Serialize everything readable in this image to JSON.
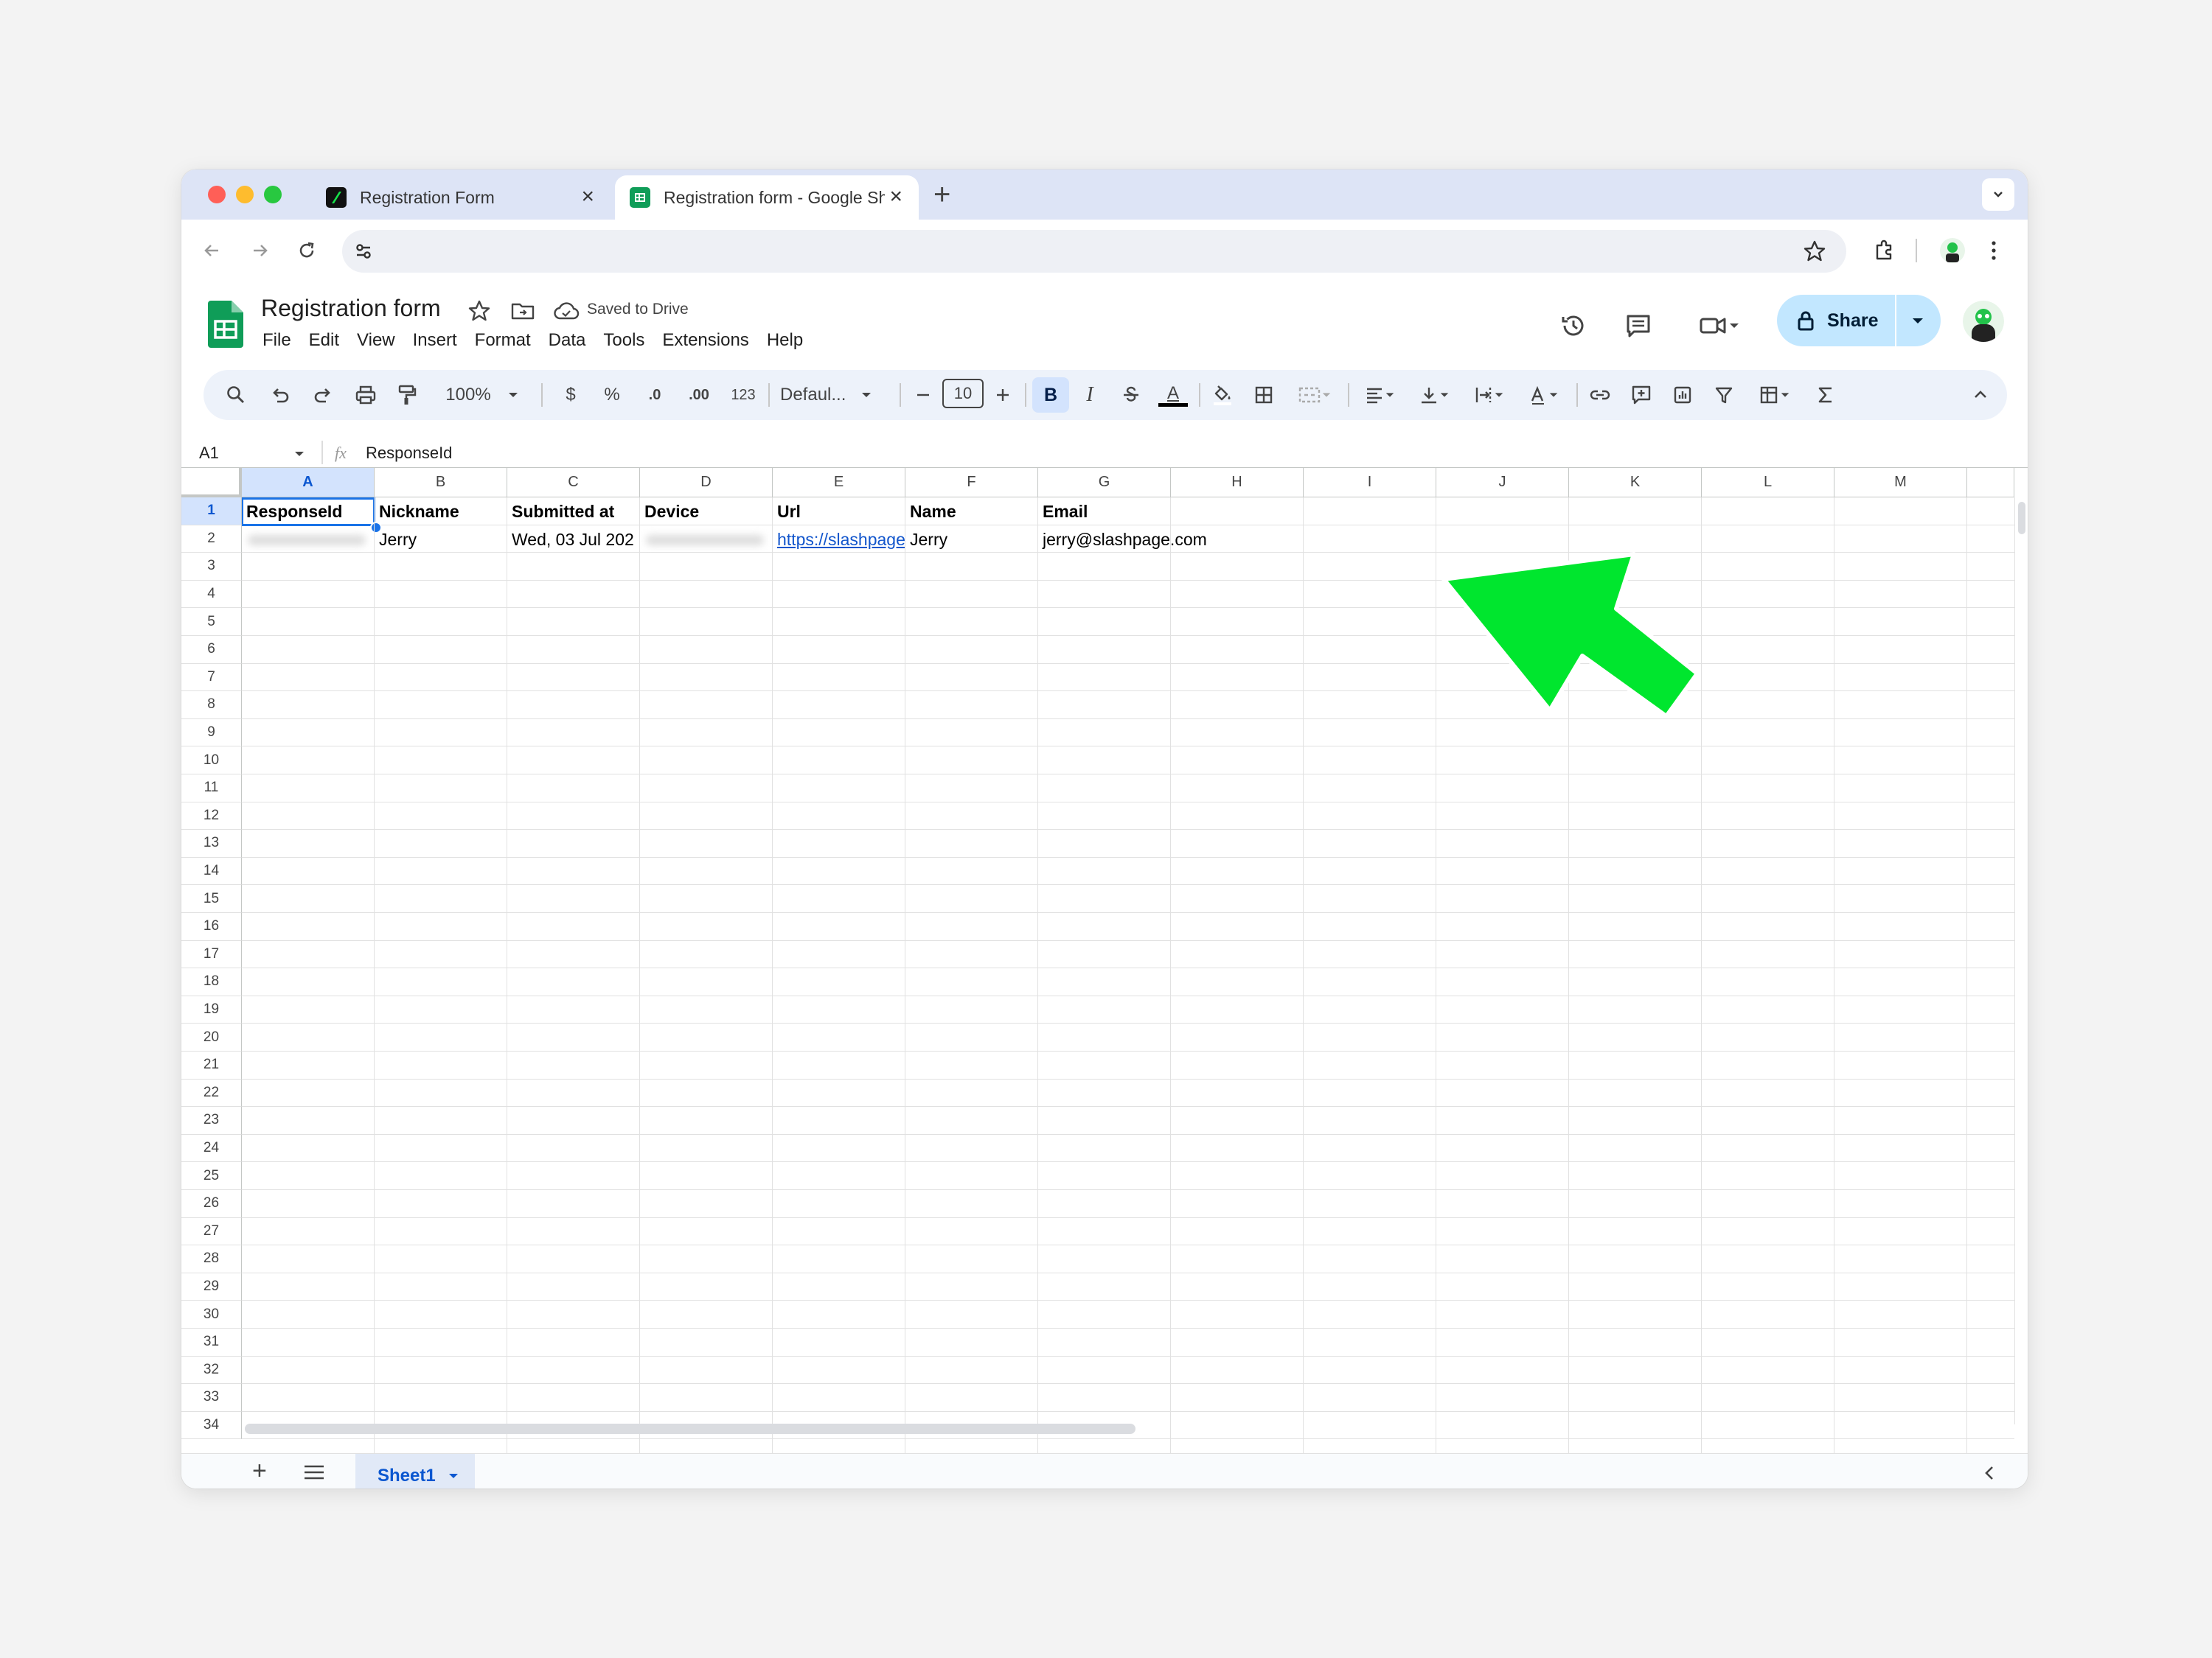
{
  "browser": {
    "tabs": [
      {
        "title": "Registration Form",
        "active": false
      },
      {
        "title": "Registration form - Google Sh",
        "active": true
      }
    ],
    "new_tab": "+",
    "close_glyph": "×"
  },
  "sheet": {
    "title": "Registration form",
    "save_status": "Saved to Drive",
    "menu": [
      "File",
      "Edit",
      "View",
      "Insert",
      "Format",
      "Data",
      "Tools",
      "Extensions",
      "Help"
    ],
    "share_label": "Share"
  },
  "toolbar": {
    "zoom": "100%",
    "currency": "$",
    "percent": "%",
    "decrease_decimal": ".0",
    "increase_decimal": ".00",
    "number_format": "123",
    "font": "Defaul...",
    "font_size": "10",
    "bold": "B",
    "italic": "I",
    "text_color": "A"
  },
  "formula_bar": {
    "cell_ref": "A1",
    "fx": "fx",
    "content": "ResponseId"
  },
  "grid": {
    "columns": [
      "A",
      "B",
      "C",
      "D",
      "E",
      "F",
      "G",
      "H",
      "I",
      "J",
      "K",
      "L",
      "M"
    ],
    "rows": [
      "1",
      "2",
      "3",
      "4",
      "5",
      "6",
      "7",
      "8",
      "9",
      "10",
      "11",
      "12",
      "13",
      "14",
      "15",
      "16",
      "17",
      "18",
      "19",
      "20",
      "21",
      "22",
      "23",
      "24",
      "25",
      "26",
      "27",
      "28",
      "29",
      "30",
      "31",
      "32",
      "33",
      "34"
    ],
    "header_row": [
      "ResponseId",
      "Nickname",
      "Submitted at",
      "Device",
      "Url",
      "Name",
      "Email"
    ],
    "data_row": {
      "nickname": "Jerry",
      "submitted_at": "Wed, 03 Jul 202",
      "url": "https://slashpage",
      "name": "Jerry",
      "email": "jerry@slashpage.com"
    }
  },
  "sheets": {
    "add": "+",
    "tab": "Sheet1"
  },
  "colors": {
    "accent": "#0b57d0",
    "share_bg": "#c2e7ff",
    "sheets_green": "#0f9d58",
    "annotation_arrow": "#00e62e"
  }
}
